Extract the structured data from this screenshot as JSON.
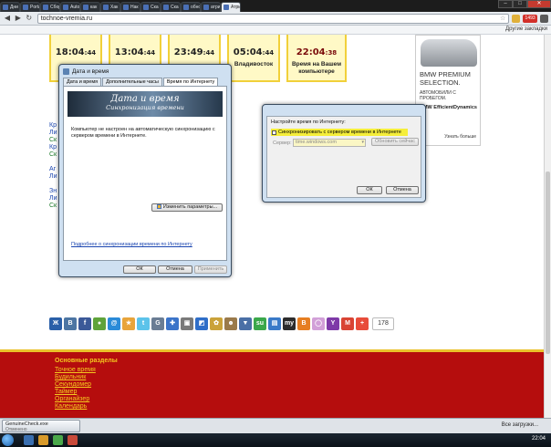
{
  "browser": {
    "tabs": [
      {
        "label": "Дни"
      },
      {
        "label": "Porta"
      },
      {
        "label": "Сбор"
      },
      {
        "label": "Auto"
      },
      {
        "label": "как"
      },
      {
        "label": "Хак"
      },
      {
        "label": "Нак"
      },
      {
        "label": "Ска"
      },
      {
        "label": "Ска"
      },
      {
        "label": "обно"
      },
      {
        "label": "атри"
      },
      {
        "label": "Атри",
        "active": true
      }
    ],
    "url": "tochnoe-vremia.ru",
    "other_bookmarks": "Другие закладки",
    "badge_count": "1493"
  },
  "clocks": [
    {
      "time": "18:04",
      "sec": ":44",
      "city": ""
    },
    {
      "time": "13:04",
      "sec": ":44",
      "city": ""
    },
    {
      "time": "23:49",
      "sec": ":44",
      "city": ""
    },
    {
      "time": "05:04",
      "sec": ":44",
      "city": "Владивосток"
    },
    {
      "time": "22:04",
      "sec": ":38",
      "city": "Время на Вашем компьютере"
    }
  ],
  "ad": {
    "headline": "BMW PREMIUM SELECTION.",
    "sub": "АВТОМОБИЛИ С ПРОБЕГОМ.",
    "efficient": "BMW EfficientDynamics",
    "more": "Узнать больше"
  },
  "left_links": [
    "Кр",
    "Ли",
    "Ск",
    "Кр",
    "Ск",
    "Аг",
    "Ли",
    "Зн",
    "Ли",
    "Ск"
  ],
  "share": {
    "count": "178",
    "buttons": [
      {
        "name": "lj-icon",
        "color": "#2a5fa8",
        "glyph": "Ж"
      },
      {
        "name": "vkontakte-icon",
        "color": "#4c75a3",
        "glyph": "B"
      },
      {
        "name": "facebook-icon",
        "color": "#3b5998",
        "glyph": "f"
      },
      {
        "name": "moikrug-icon",
        "color": "#5fa33a",
        "glyph": "●"
      },
      {
        "name": "mailru-icon",
        "color": "#2a8bd8",
        "glyph": "@"
      },
      {
        "name": "favorites-icon",
        "color": "#e8a43a",
        "glyph": "★"
      },
      {
        "name": "twitter-icon",
        "color": "#5cc3ea",
        "glyph": "t"
      },
      {
        "name": "google-icon",
        "color": "#6a7d94",
        "glyph": "G"
      },
      {
        "name": "bobrdobr-icon",
        "color": "#3b74c9",
        "glyph": "✚"
      },
      {
        "name": "print-icon",
        "color": "#7a7a7a",
        "glyph": "▣"
      },
      {
        "name": "delicious-icon",
        "color": "#2f6ec8",
        "glyph": "◩"
      },
      {
        "name": "memori-icon",
        "color": "#caa23a",
        "glyph": "✿"
      },
      {
        "name": "news2-icon",
        "color": "#9a7a4a",
        "glyph": "☻"
      },
      {
        "name": "digg-icon",
        "color": "#4a6fa6",
        "glyph": "▼"
      },
      {
        "name": "stumbleupon-icon",
        "color": "#3aa84a",
        "glyph": "su"
      },
      {
        "name": "linkstore-icon",
        "color": "#3a7ac8",
        "glyph": "▤"
      },
      {
        "name": "myspace-icon",
        "color": "#2c2c2c",
        "glyph": "my"
      },
      {
        "name": "blogger-icon",
        "color": "#e67e22",
        "glyph": "B"
      },
      {
        "name": "odnoklassniki-icon",
        "color": "#d2a0d8",
        "glyph": "◯"
      },
      {
        "name": "yahoo-icon",
        "color": "#7e3aa8",
        "glyph": "Y"
      },
      {
        "name": "gmail-icon",
        "color": "#d94434",
        "glyph": "M"
      },
      {
        "name": "more-share-icon",
        "color": "#e84c3a",
        "glyph": "+"
      }
    ]
  },
  "footer": {
    "heading": "Основные разделы",
    "links": [
      "Точное время",
      "Будильник",
      "Секундомер",
      "Таймер",
      "Органайзер",
      "Календарь"
    ]
  },
  "dialog_datetime": {
    "title": "Дата и время",
    "tabs": [
      "Дата и время",
      "Дополнительные часы",
      "Время по Интернету"
    ],
    "banner_title": "Дата и время",
    "banner_sub": "Синхронизация времени",
    "message": "Компьютер не настроен на автоматическую синхронизацию с сервером времени в Интернете.",
    "change_btn": "Изменить параметры...",
    "link": "Подробнее о синхронизации времени по Интернету",
    "ok": "ОК",
    "cancel": "Отмена",
    "apply": "Применить"
  },
  "dialog_internet": {
    "heading": "Настройте время по Интернету:",
    "checkbox": "Синхронизировать с сервером времени в Интернете",
    "server_label": "Сервер:",
    "server_value": "time.windows.com",
    "update_btn": "Обновить сейчас",
    "ok": "ОК",
    "cancel": "Отмена"
  },
  "downloads": {
    "file": "GenuineCheck.exe",
    "status": "Отменено",
    "all": "Все загрузки..."
  },
  "taskbar": {
    "time": "22:04"
  }
}
